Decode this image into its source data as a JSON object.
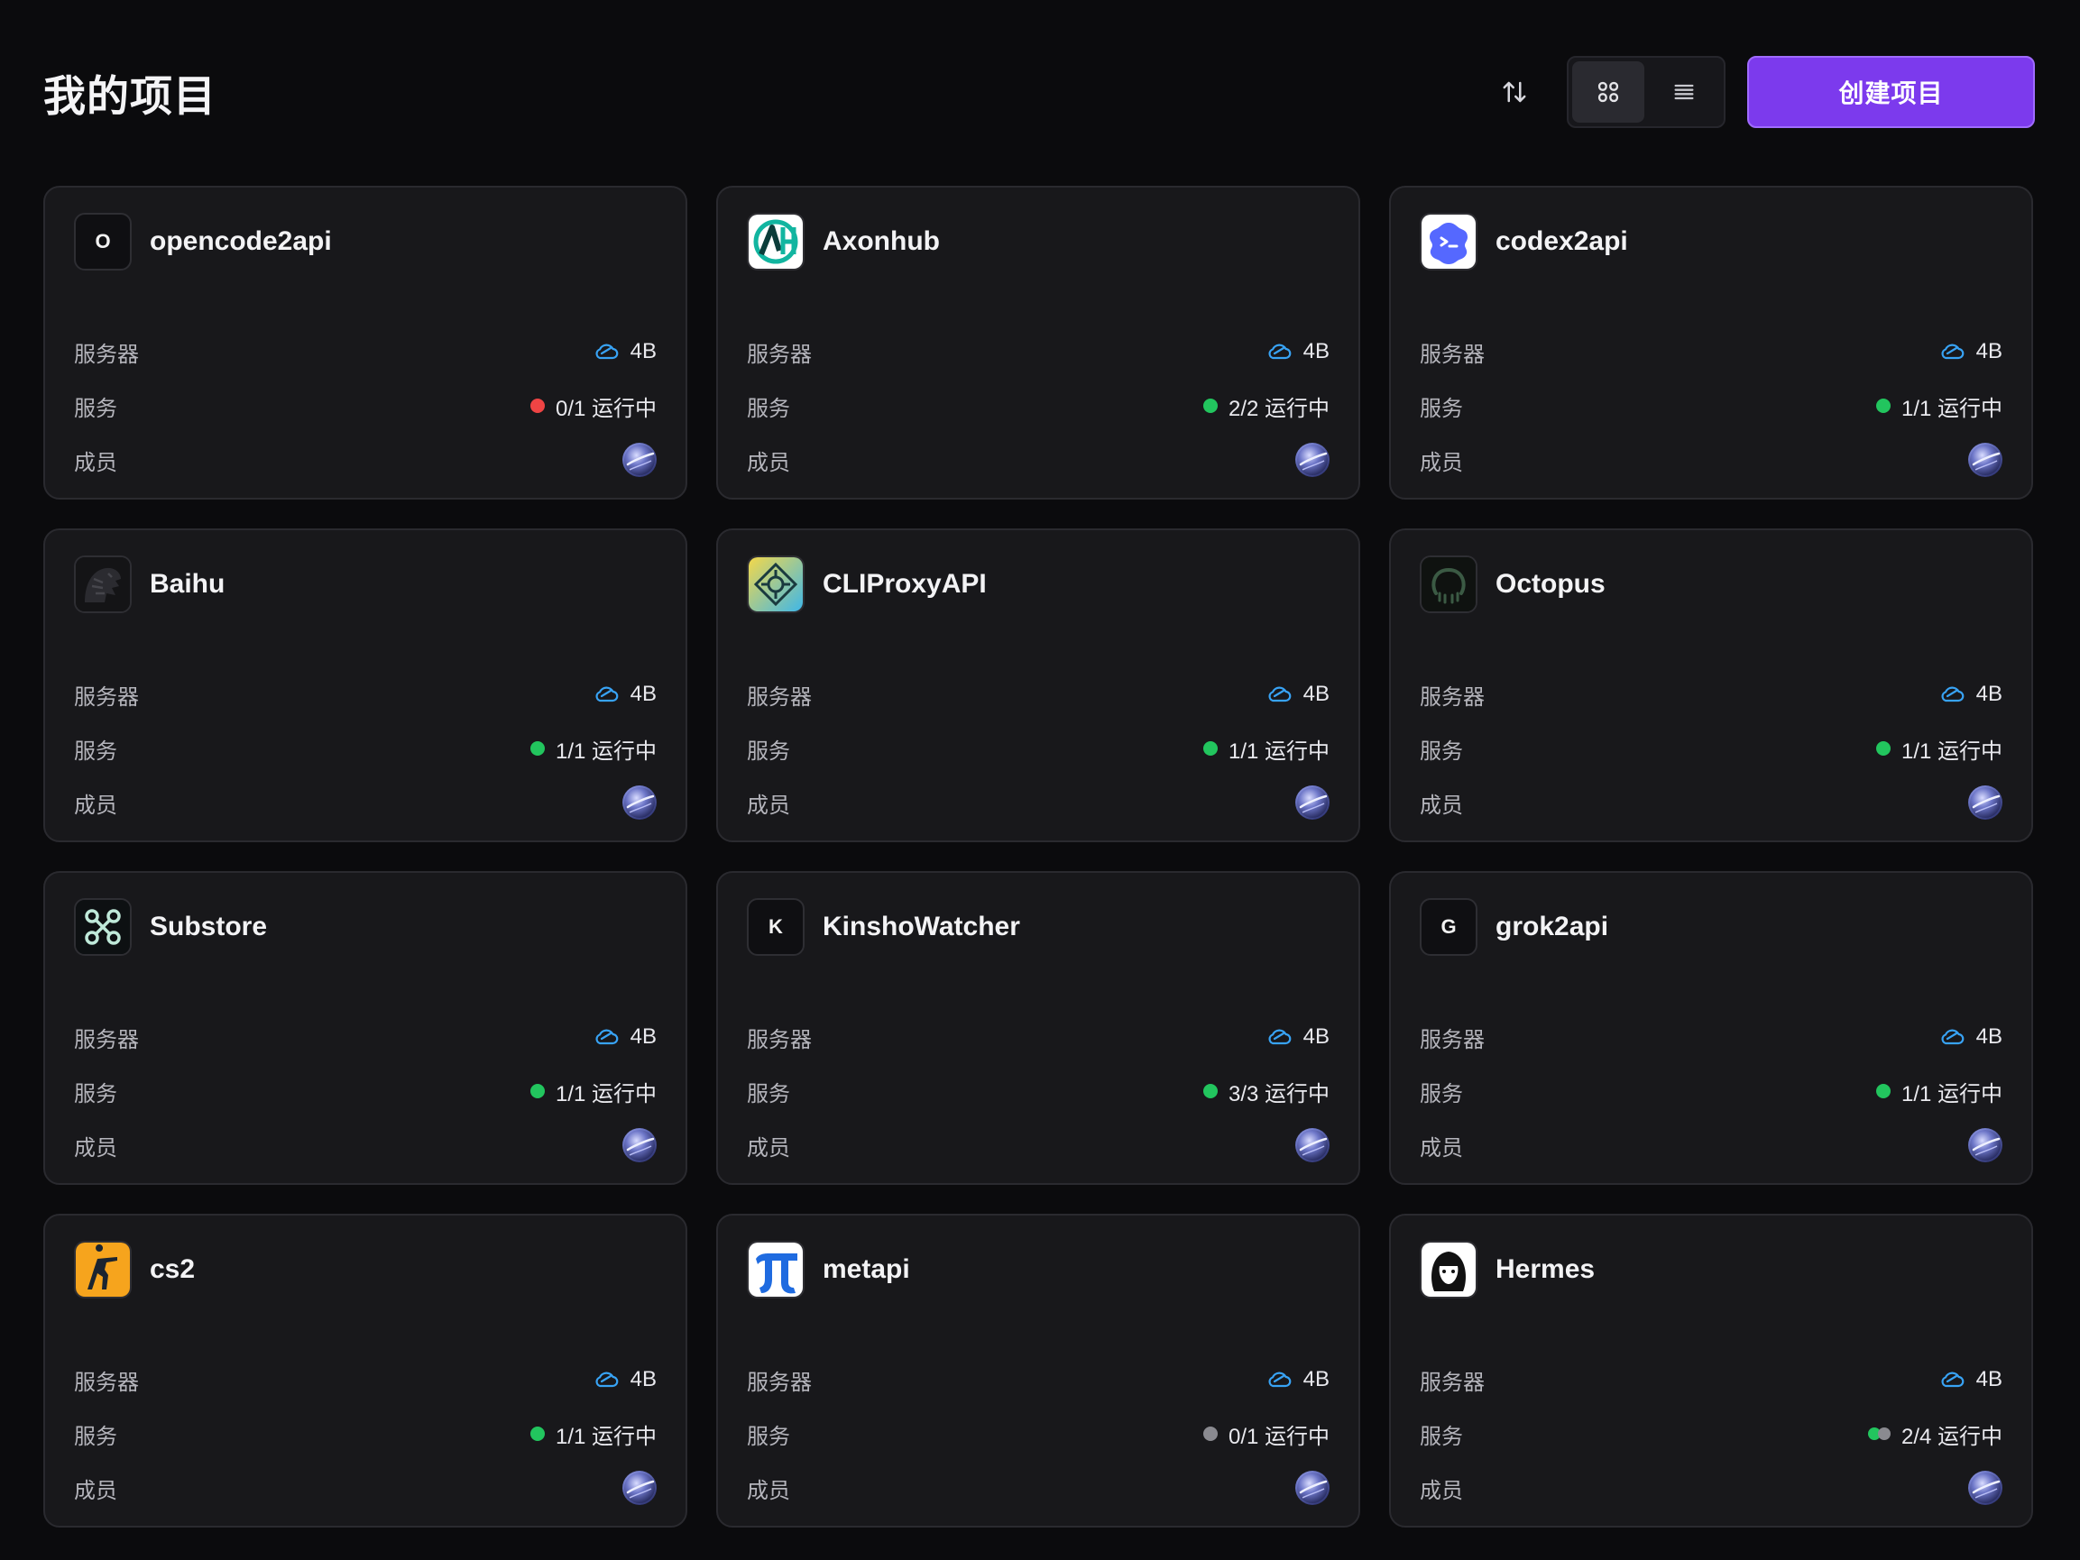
{
  "header": {
    "title": "我的项目",
    "create_label": "创建项目",
    "sort_icon": "sort-icon",
    "grid_view_icon": "grid-view-icon",
    "list_view_icon": "list-view-icon"
  },
  "labels": {
    "server": "服务器",
    "service": "服务",
    "members": "成员",
    "running_suffix": "运行中"
  },
  "colors": {
    "accent": "#7c3aed",
    "green": "#22c55e",
    "red": "#ef4444",
    "gray": "#8a8a90",
    "cloud_blue": "#38a3f5"
  },
  "projects": [
    {
      "name": "opencode2api",
      "icon": "letter",
      "letter": "O",
      "server": "4B",
      "services": "0/1 运行中",
      "status": "red"
    },
    {
      "name": "Axonhub",
      "icon": "axonhub-logo",
      "server": "4B",
      "services": "2/2 运行中",
      "status": "green"
    },
    {
      "name": "codex2api",
      "icon": "codex-logo",
      "server": "4B",
      "services": "1/1 运行中",
      "status": "green"
    },
    {
      "name": "Baihu",
      "icon": "tiger-logo",
      "server": "4B",
      "services": "1/1 运行中",
      "status": "green"
    },
    {
      "name": "CLIProxyAPI",
      "icon": "cliproxy-logo",
      "server": "4B",
      "services": "1/1 运行中",
      "status": "green"
    },
    {
      "name": "Octopus",
      "icon": "octopus-logo",
      "server": "4B",
      "services": "1/1 运行中",
      "status": "green"
    },
    {
      "name": "Substore",
      "icon": "substore-logo",
      "server": "4B",
      "services": "1/1 运行中",
      "status": "green"
    },
    {
      "name": "KinshoWatcher",
      "icon": "letter",
      "letter": "K",
      "server": "4B",
      "services": "3/3 运行中",
      "status": "green"
    },
    {
      "name": "grok2api",
      "icon": "letter",
      "letter": "G",
      "server": "4B",
      "services": "1/1 运行中",
      "status": "green"
    },
    {
      "name": "cs2",
      "icon": "cs2-logo",
      "server": "4B",
      "services": "1/1 运行中",
      "status": "green"
    },
    {
      "name": "metapi",
      "icon": "pi-logo",
      "server": "4B",
      "services": "0/1 运行中",
      "status": "gray"
    },
    {
      "name": "Hermes",
      "icon": "hermes-logo",
      "server": "4B",
      "services": "2/4 运行中",
      "status": "mixed"
    }
  ]
}
